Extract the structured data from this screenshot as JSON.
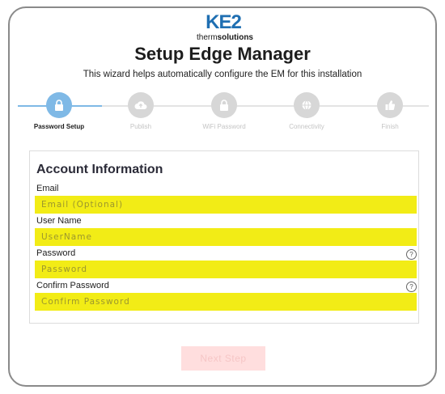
{
  "header": {
    "logo_mark": "KE2",
    "logo_tag_prefix": "therm",
    "logo_tag_bold": "solutions",
    "title": "Setup Edge Manager",
    "subtitle": "This wizard helps automatically configure the EM for this installation"
  },
  "stepper": {
    "steps": [
      {
        "label": "Password Setup",
        "icon": "lock-icon",
        "active": true
      },
      {
        "label": "Publish",
        "icon": "cloud-upload-icon",
        "active": false
      },
      {
        "label": "WiFi Password",
        "icon": "lock-icon",
        "active": false
      },
      {
        "label": "Connectivity",
        "icon": "globe-icon",
        "active": false
      },
      {
        "label": "Finish",
        "icon": "thumbs-up-icon",
        "active": false
      }
    ]
  },
  "account": {
    "title": "Account Information",
    "email_label": "Email",
    "email_placeholder": "Email (Optional)",
    "username_label": "User Name",
    "username_placeholder": "UserName",
    "password_label": "Password",
    "password_placeholder": "Password",
    "confirm_label": "Confirm Password",
    "confirm_placeholder": "Confirm Password",
    "help_glyph": "?"
  },
  "footer": {
    "next_label": "Next Step"
  },
  "colors": {
    "active_step": "#7fb9e6",
    "inactive_step": "#d7d7d7",
    "field_highlight": "#f2ec16",
    "next_button": "#ffdede"
  }
}
